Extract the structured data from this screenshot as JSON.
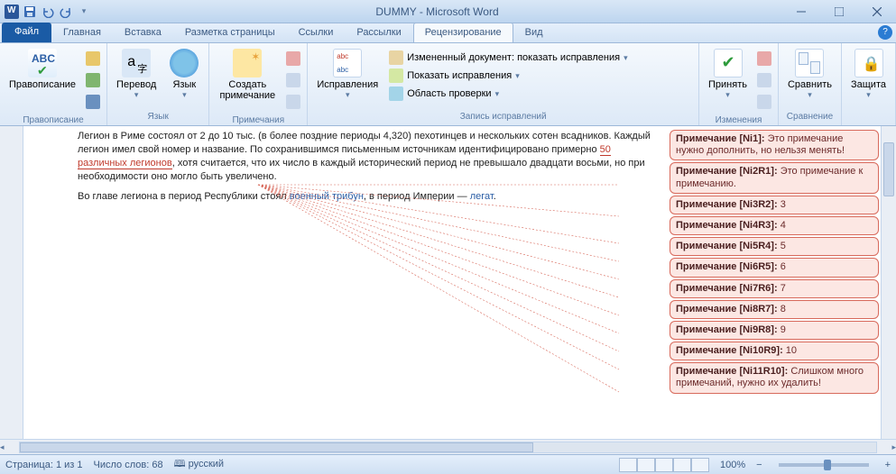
{
  "title": "DUMMY - Microsoft Word",
  "tabs": {
    "file": "Файл",
    "home": "Главная",
    "insert": "Вставка",
    "layout": "Разметка страницы",
    "refs": "Ссылки",
    "mail": "Рассылки",
    "review": "Рецензирование",
    "view": "Вид"
  },
  "ribbon": {
    "proofing": {
      "spelling": "Правописание",
      "label": "Правописание"
    },
    "language": {
      "translate": "Перевод",
      "lang": "Язык",
      "label": "Язык"
    },
    "comments": {
      "new": "Создать примечание",
      "label": "Примечания"
    },
    "tracking": {
      "track": "Исправления",
      "doc": "Измененный документ: показать исправления",
      "show": "Показать исправления",
      "pane": "Область проверки",
      "label": "Запись исправлений"
    },
    "changes": {
      "accept": "Принять",
      "label": "Изменения"
    },
    "compare": {
      "compare": "Сравнить",
      "label": "Сравнение"
    },
    "protect": {
      "protect": "Защита",
      "label": ""
    }
  },
  "doc": {
    "p1a": "Легион в Риме состоял от 2 до 10 тыс. (в более поздние периоды 4,320) пехотинцев и нескольких сотен всадников. Каждый легион имел свой номер и название. По сохранившимся письменным источникам идентифицировано примерно ",
    "p1mark": "50 различных легионов",
    "p1b": ", хотя считается, что их число в каждый исторический период не превышало двадцати восьми, но при необходимости оно могло быть увеличено.",
    "p2a": "Во главе легиона в период Республики стоял ",
    "p2link1": "военный трибун",
    "p2b": ", в период Империи — ",
    "p2link2": "легат",
    "p2c": "."
  },
  "comments": [
    {
      "label": "Примечание [Ni1]: ",
      "text": "Это примечание нужно дополнить, но нельзя менять!"
    },
    {
      "label": "Примечание [Ni2R1]: ",
      "text": "Это примечание к примечанию."
    },
    {
      "label": "Примечание [Ni3R2]: ",
      "text": "3"
    },
    {
      "label": "Примечание [Ni4R3]: ",
      "text": "4"
    },
    {
      "label": "Примечание [Ni5R4]: ",
      "text": "5"
    },
    {
      "label": "Примечание [Ni6R5]: ",
      "text": "6"
    },
    {
      "label": "Примечание [Ni7R6]: ",
      "text": "7"
    },
    {
      "label": "Примечание [Ni8R7]: ",
      "text": "8"
    },
    {
      "label": "Примечание [Ni9R8]: ",
      "text": "9"
    },
    {
      "label": "Примечание [Ni10R9]: ",
      "text": "10"
    },
    {
      "label": "Примечание [Ni11R10]: ",
      "text": "Слишком много примечаний, нужно их удалить!"
    }
  ],
  "status": {
    "page": "Страница: 1 из 1",
    "words": "Число слов: 68",
    "lang": "русский",
    "zoom": "100%"
  }
}
